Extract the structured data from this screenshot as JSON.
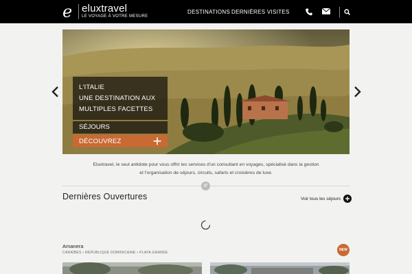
{
  "header": {
    "logo_letter": "e",
    "logo_name": "eluxtravel",
    "logo_tagline": "LE VOYAGE À VOTRE MESURE",
    "nav": [
      {
        "label": "DESTINATIONS"
      },
      {
        "label": "DERNIÈRES VISITES"
      }
    ],
    "icons": [
      "phone-icon",
      "mail-icon",
      "search-icon"
    ]
  },
  "hero": {
    "caption_lines": [
      "L'ITALIE",
      "UNE DESTINATION AUX",
      "MULTIPLES FACETTES"
    ],
    "sejours_label": "SÉJOURS",
    "cta_label": "DÉCOUVREZ",
    "cta_icon": "plus-icon"
  },
  "intro": {
    "line1": "Eluxtravel, le seul antidote pour vous offrir les services d'un consultant en voyages, spécialisé dans la gestion",
    "line2": "et l'organisation de séjours, circuits, safaris et croisières de luxe."
  },
  "divider_badge": "e",
  "section": {
    "title": "Dernières Ouvertures",
    "see_all": "Voir tous les séjours"
  },
  "listing": {
    "name": "Amanera",
    "location": "CARAÏBES • RÉPUBLIQUE DOMINICAINE • PLAYA GRANDE",
    "badge": "NEW"
  },
  "colors": {
    "header_bg": "#000000",
    "accent": "#c96a34",
    "page_bg": "#f2f2f0"
  }
}
